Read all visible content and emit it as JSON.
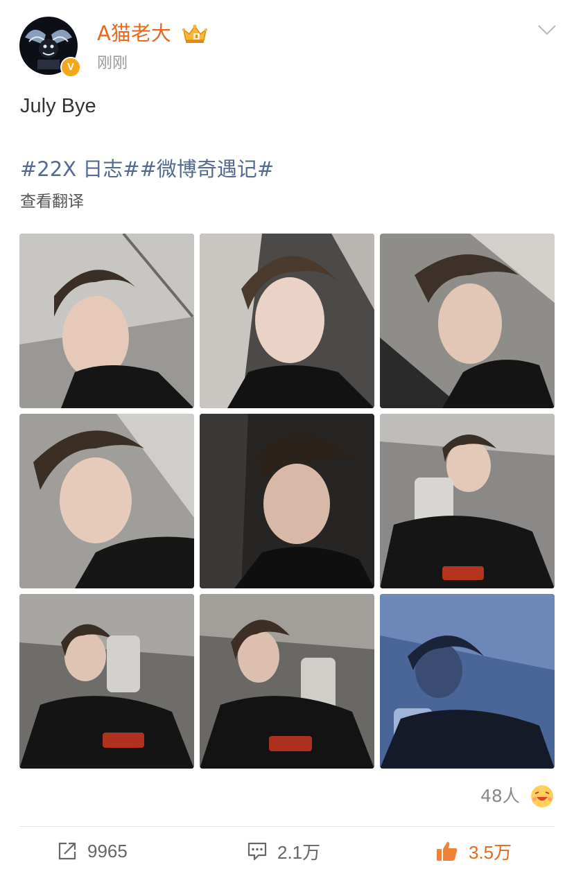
{
  "post": {
    "author": {
      "name": "A猫老大",
      "verified_badge": "V",
      "crown_icon": "crown-icon",
      "timestamp": "刚刚"
    },
    "text": "July Bye",
    "hashtags": "#22X 日志##微博奇遇记#",
    "translate_label": "查看翻译",
    "photos": [
      {
        "name": "photo-1",
        "tone": "#8a8784"
      },
      {
        "name": "photo-2",
        "tone": "#5e5b58"
      },
      {
        "name": "photo-3",
        "tone": "#7c7a77"
      },
      {
        "name": "photo-4",
        "tone": "#8e8c88"
      },
      {
        "name": "photo-5",
        "tone": "#2e2d2c"
      },
      {
        "name": "photo-6",
        "tone": "#707070"
      },
      {
        "name": "photo-7",
        "tone": "#5a5856"
      },
      {
        "name": "photo-8",
        "tone": "#55524f"
      },
      {
        "name": "photo-9",
        "tone": "#4f6a9a"
      }
    ],
    "reactions": {
      "count": "48人",
      "emoji_icon": "laughing-emoji-icon"
    },
    "actions": {
      "repost_count": "9965",
      "comment_count": "2.1万",
      "like_count": "3.5万"
    },
    "colors": {
      "username": "#e8681d",
      "hashtag": "#526991",
      "like": "#e8681d",
      "badge": "#f7a51b"
    }
  }
}
